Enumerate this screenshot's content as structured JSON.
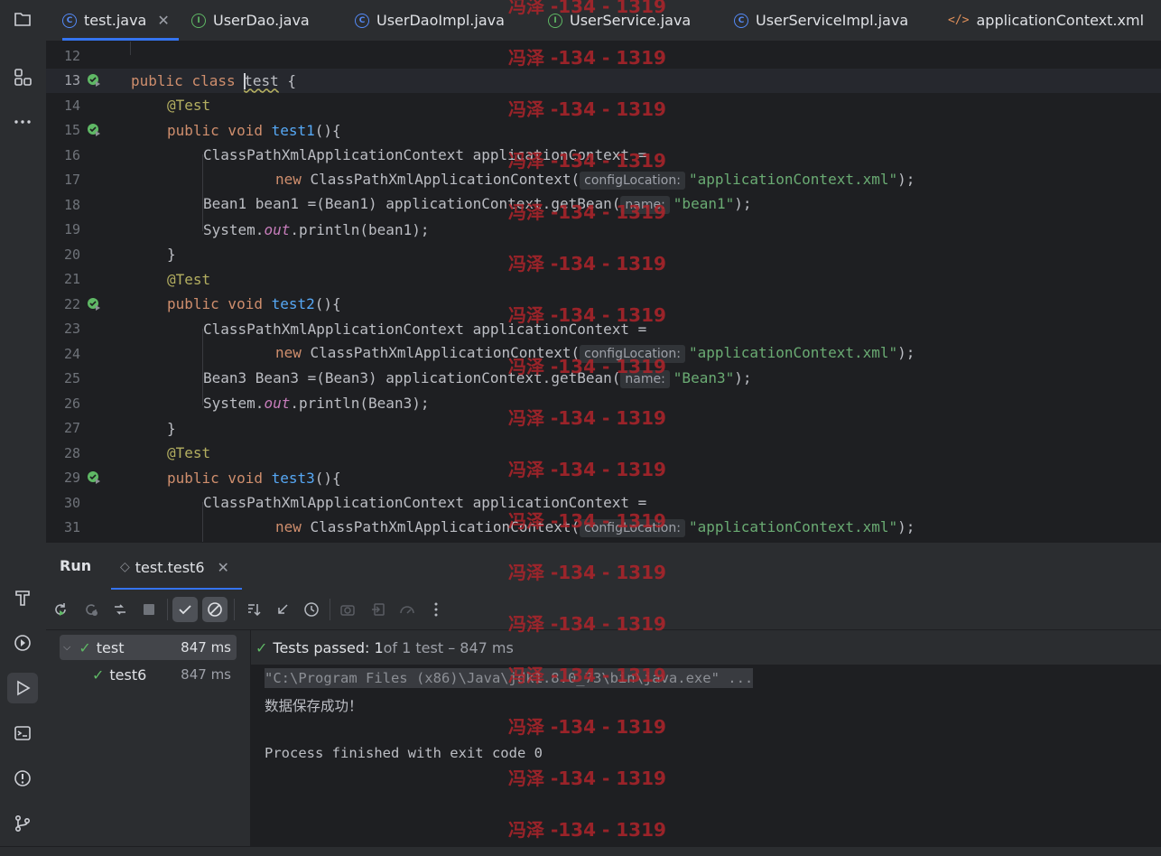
{
  "tabs": [
    {
      "label": "test.java",
      "icon": "class-icon",
      "active": true
    },
    {
      "label": "UserDao.java",
      "icon": "interface-icon"
    },
    {
      "label": "UserDaoImpl.java",
      "icon": "class-icon"
    },
    {
      "label": "UserService.java",
      "icon": "interface-icon"
    },
    {
      "label": "UserServiceImpl.java",
      "icon": "class-icon"
    },
    {
      "label": "applicationContext.xml",
      "icon": "xml-icon"
    }
  ],
  "editor": {
    "line_numbers": [
      "12",
      "13",
      "14",
      "15",
      "16",
      "17",
      "18",
      "19",
      "20",
      "21",
      "22",
      "23",
      "24",
      "25",
      "26",
      "27",
      "28",
      "29",
      "30",
      "31"
    ],
    "l13": {
      "kw1": "public",
      "kw2": "class",
      "cls": "test",
      "rest": " {"
    },
    "ann": "@Test",
    "m1": {
      "kw": "public void",
      "name": "test1",
      "rest": "(){"
    },
    "m2": {
      "kw": "public void",
      "name": "test2",
      "rest": "(){"
    },
    "m3": {
      "kw": "public void",
      "name": "test3",
      "rest": "(){"
    },
    "ctx_decl": "ClassPathXmlApplicationContext applicationContext =",
    "new_kw": "new",
    "new_rest": " ClassPathXmlApplicationContext(",
    "hint_config": "configLocation:",
    "str_ctx": "\"applicationContext.xml\"",
    "end_paren": ");",
    "l18_pre": "Bean1 bean1 =(Bean1) applicationContext.getBean(",
    "hint_name": "name:",
    "str_bean1": "\"bean1\"",
    "l25_pre": "Bean3 Bean3 =(Bean3) applicationContext.getBean(",
    "str_bean3": "\"Bean3\"",
    "sys": "System.",
    "out": "out",
    "println1": ".println(bean1);",
    "println3": ".println(Bean3);",
    "close_brace": "}"
  },
  "run": {
    "title": "Run",
    "tab_label": "test.test6",
    "tree": [
      {
        "label": "test",
        "time": "847 ms"
      },
      {
        "label": "test6",
        "time": "847 ms"
      }
    ],
    "status_passed": "Tests passed: 1",
    "status_rest": " of 1 test – 847 ms",
    "console": [
      "\"C:\\Program Files (x86)\\Java\\jdk1.8.0_73\\bin\\java.exe\" ...",
      "数据保存成功！",
      "",
      "Process finished with exit code 0"
    ]
  },
  "watermark": "冯泽 -134 - 1319",
  "colors": {
    "accent": "#3574f0",
    "pass": "#5fb865",
    "watermark": "#b0242b"
  }
}
